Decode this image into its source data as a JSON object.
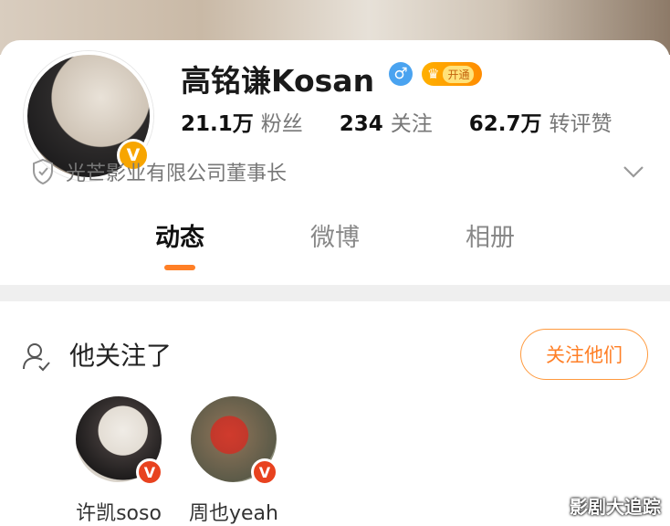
{
  "profile": {
    "name": "高铭谦Kosan",
    "gender_icon": "male",
    "vip_label": "开通",
    "stats": [
      {
        "value": "21.1万",
        "label": "粉丝"
      },
      {
        "value": "234",
        "label": "关注"
      },
      {
        "value": "62.7万",
        "label": "转评赞"
      }
    ],
    "certification": "光芒影业有限公司董事长",
    "verified_badge": "V"
  },
  "tabs": [
    {
      "label": "动态",
      "active": true
    },
    {
      "label": "微博",
      "active": false
    },
    {
      "label": "相册",
      "active": false
    }
  ],
  "following": {
    "title": "他关注了",
    "follow_button": "关注他们",
    "users": [
      {
        "name": "许凯soso",
        "badge": "V"
      },
      {
        "name": "周也yeah",
        "badge": "V"
      }
    ]
  },
  "watermark": "影剧大追踪",
  "colors": {
    "accent": "#ff7f26",
    "verified_gold": "#f7a500",
    "verified_red": "#e8421f",
    "gender_blue": "#4aa3f0"
  }
}
